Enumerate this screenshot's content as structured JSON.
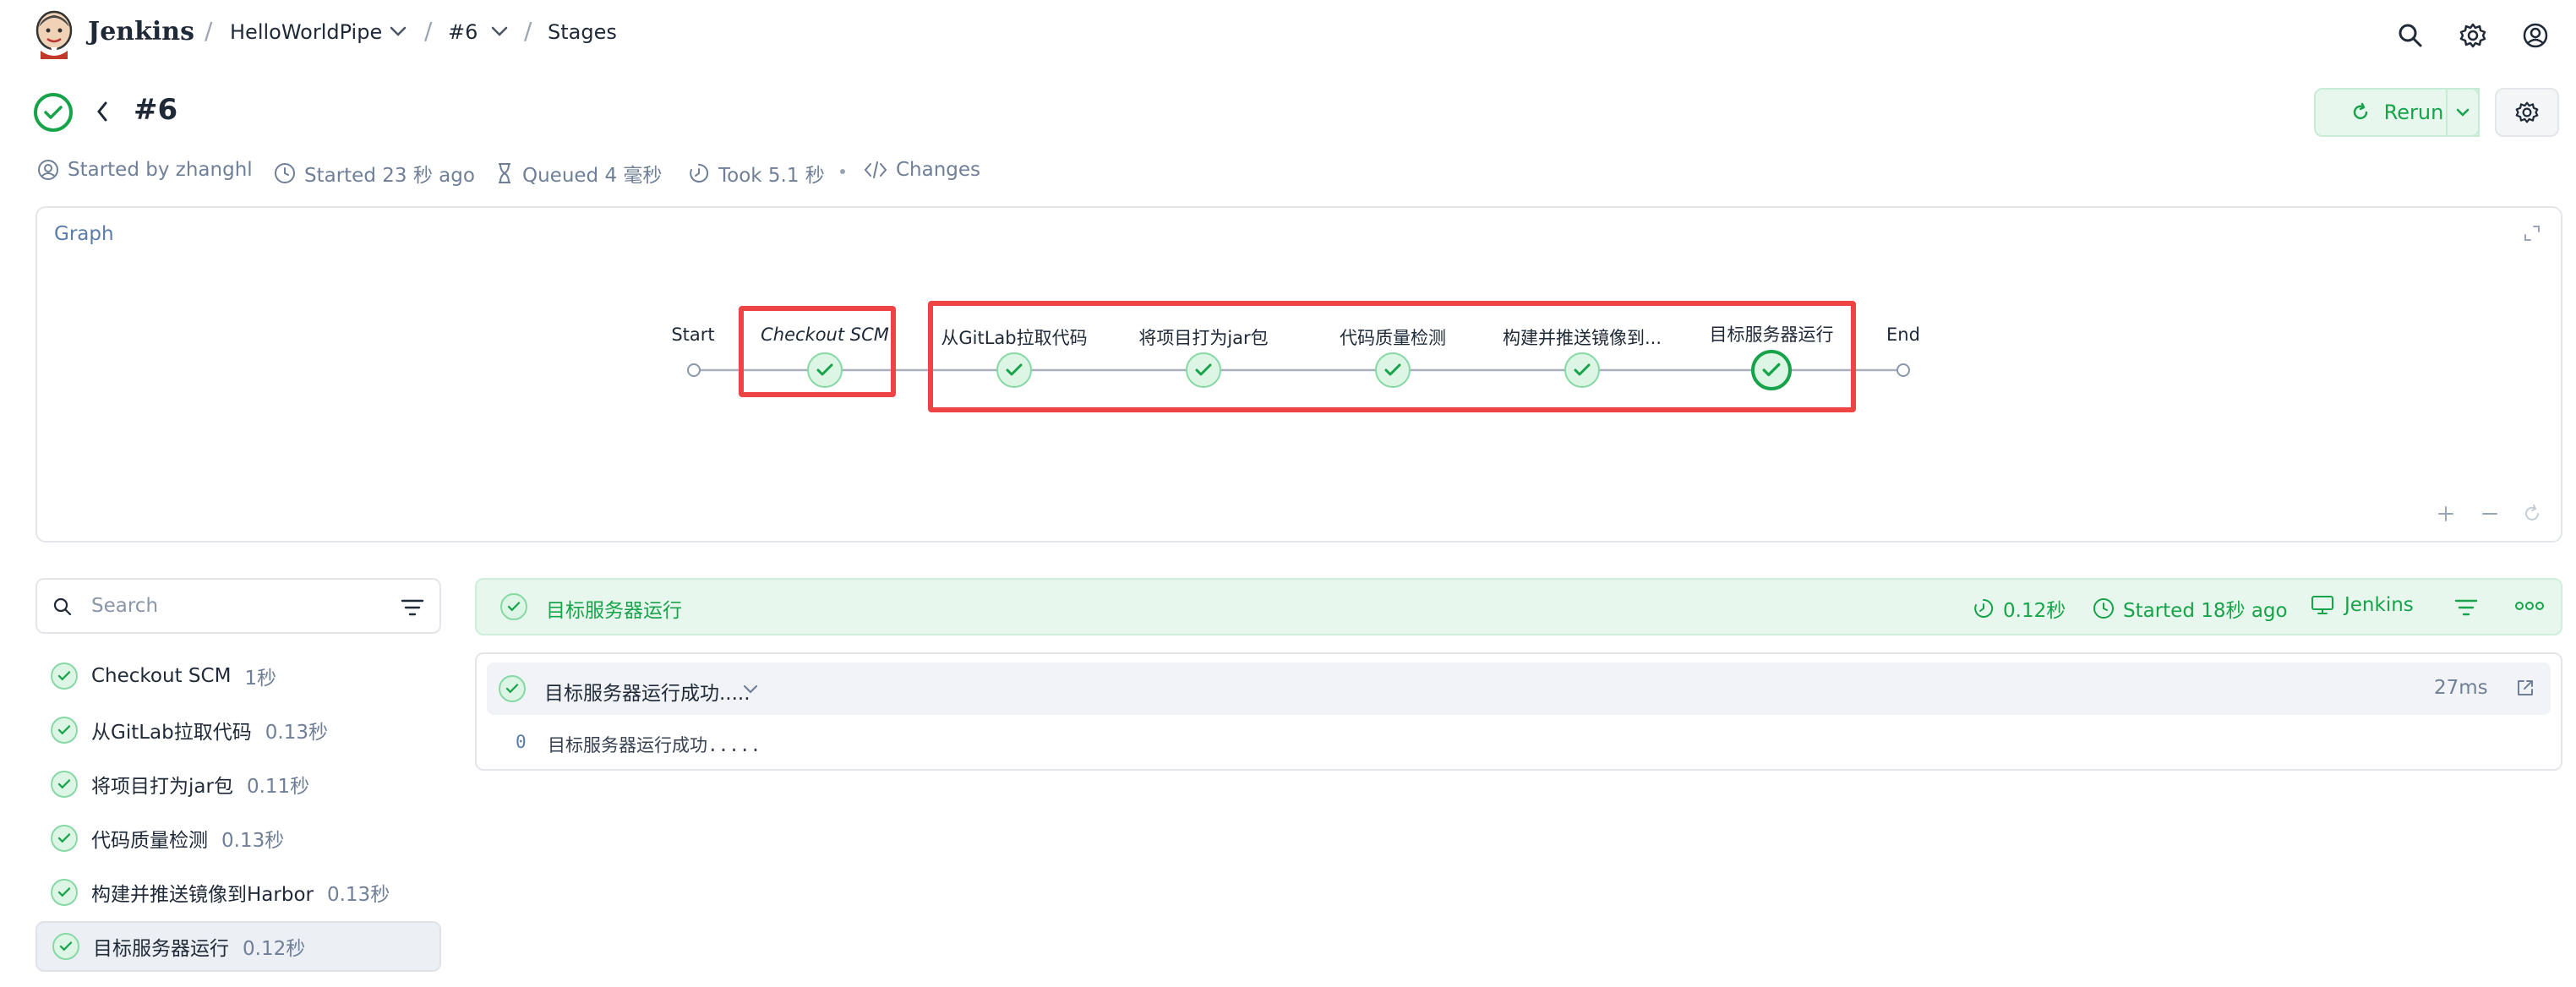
{
  "header": {
    "brand": "Jenkins",
    "breadcrumbs": [
      "HelloWorldPipe",
      "#6",
      "Stages"
    ]
  },
  "run": {
    "title": "#6",
    "rerun_label": "Rerun",
    "meta": {
      "started_by": "Started by zhanghl",
      "started": "Started 23 秒 ago",
      "queued": "Queued 4 毫秒",
      "took": "Took 5.1 秒",
      "changes": "Changes"
    }
  },
  "graph": {
    "title": "Graph",
    "start_label": "Start",
    "end_label": "End",
    "nodes": [
      {
        "label": "Checkout SCM",
        "status": "success"
      },
      {
        "label": "从GitLab拉取代码",
        "status": "success"
      },
      {
        "label": "将项目打为jar包",
        "status": "success"
      },
      {
        "label": "代码质量检测",
        "status": "success"
      },
      {
        "label": "构建并推送镜像到...",
        "status": "success"
      },
      {
        "label": "目标服务器运行",
        "status": "success",
        "selected": true
      }
    ]
  },
  "stages_panel": {
    "search_placeholder": "Search",
    "items": [
      {
        "name": "Checkout SCM",
        "duration": "1秒"
      },
      {
        "name": "从GitLab拉取代码",
        "duration": "0.13秒"
      },
      {
        "name": "将项目打为jar包",
        "duration": "0.11秒"
      },
      {
        "name": "代码质量检测",
        "duration": "0.13秒"
      },
      {
        "name": "构建并推送镜像到Harbor",
        "duration": "0.13秒"
      },
      {
        "name": "目标服务器运行",
        "duration": "0.12秒",
        "active": true
      }
    ]
  },
  "detail": {
    "stage_name": "目标服务器运行",
    "duration": "0.12秒",
    "started": "Started 18秒 ago",
    "agent": "Jenkins",
    "step": {
      "title": "目标服务器运行成功.....",
      "duration": "27ms",
      "log_line_no": "0",
      "log_text": "目标服务器运行成功....."
    }
  },
  "colors": {
    "success": "#16a34a",
    "success_bg": "#e8f7ee",
    "highlight_box": "#ef4444",
    "muted": "#6f7f97"
  }
}
